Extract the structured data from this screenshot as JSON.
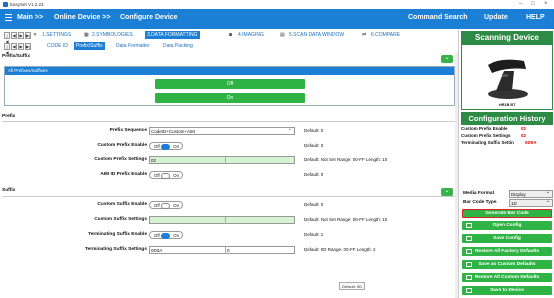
{
  "window": {
    "title": "EasySet V1.2.23"
  },
  "topbar": {
    "main": "Main >>",
    "online_device": "Online Device >>",
    "configure_device": "Configure Device",
    "command_search": "Command Search",
    "update": "Update",
    "help": "HELP"
  },
  "tabs": [
    {
      "label": "1.SETTINGS"
    },
    {
      "label": "2.SYMBOLOGIES"
    },
    {
      "label": "3.DATA FORMATTING"
    },
    {
      "label": "4.IMAGING"
    },
    {
      "label": "5.SCAN DATA WINDOW"
    },
    {
      "label": "6.COMPARE"
    }
  ],
  "subtabs": [
    "CODE ID",
    "Prefix/Suffix",
    "Data Formatter",
    "Data Packing"
  ],
  "prefix_suffix": {
    "section_title": "Prefix/Suffix",
    "all_header": "All Prefixes/Suffixes",
    "off_label": "Off",
    "on_label": "On"
  },
  "prefix": {
    "section_title": "Prefix",
    "sequence_label": "Prefix Sequence",
    "sequence_value": "CodeID+Custom+AIM",
    "sequence_default": "Default: 0",
    "custom_enable_label": "Custom Prefix Enable",
    "custom_enable_default": "Default: 0",
    "custom_settings_label": "Custom Prefix Settings",
    "custom_settings_value": "02",
    "custom_settings_note": "Default: Not Set   Range: 00-FF Length: 10",
    "aim_enable_label": "AIM ID Prefix Enable",
    "aim_enable_default": "Default: 0"
  },
  "suffix": {
    "section_title": "Suffix",
    "custom_enable_label": "Custom Suffix Enable",
    "custom_enable_default": "Default: 0",
    "custom_settings_label": "Custom Suffix Settings",
    "custom_settings_note": "Default: Not Set   Range: 00-FF Length: 10",
    "term_enable_label": "Terminating  Suffix Enable",
    "term_enable_default": "Default: 1",
    "term_settings_label": "Terminating  Suffix Settings",
    "term_settings_value": "0D0A",
    "term_settings_value2": "0",
    "term_settings_note": "Default: 0D   Range: 00-FF Length: 2",
    "tooltip": "Default: 0D"
  },
  "toggle": {
    "off": "Off",
    "on": "On"
  },
  "right_panel": {
    "scanning_device": "Scanning Device",
    "model": "HR1B BT",
    "config_history": "Configuration History",
    "history": [
      {
        "label": "Custom Prefix Enable",
        "value": "01"
      },
      {
        "label": "Custom Prefix Settings",
        "value": "02"
      },
      {
        "label": "Terminating  Suffix Settin",
        "value": "0D0A"
      }
    ],
    "media_format_label": "Media Format",
    "media_format_value": "Display",
    "bar_code_type_label": "Bar Code Type",
    "bar_code_type_value": "1D",
    "buttons": [
      "Generate Bar Code",
      "Open Config",
      "Save Config",
      "Restore All Factory Defaults",
      "Save as Custom Defaults",
      "Restore All Custom Defaults",
      "Save to Device"
    ]
  },
  "colors": {
    "brand_blue": "#1b7fd6",
    "green": "#2fb344",
    "dark_green": "#2d8b45",
    "history_red": "#dd0000"
  }
}
